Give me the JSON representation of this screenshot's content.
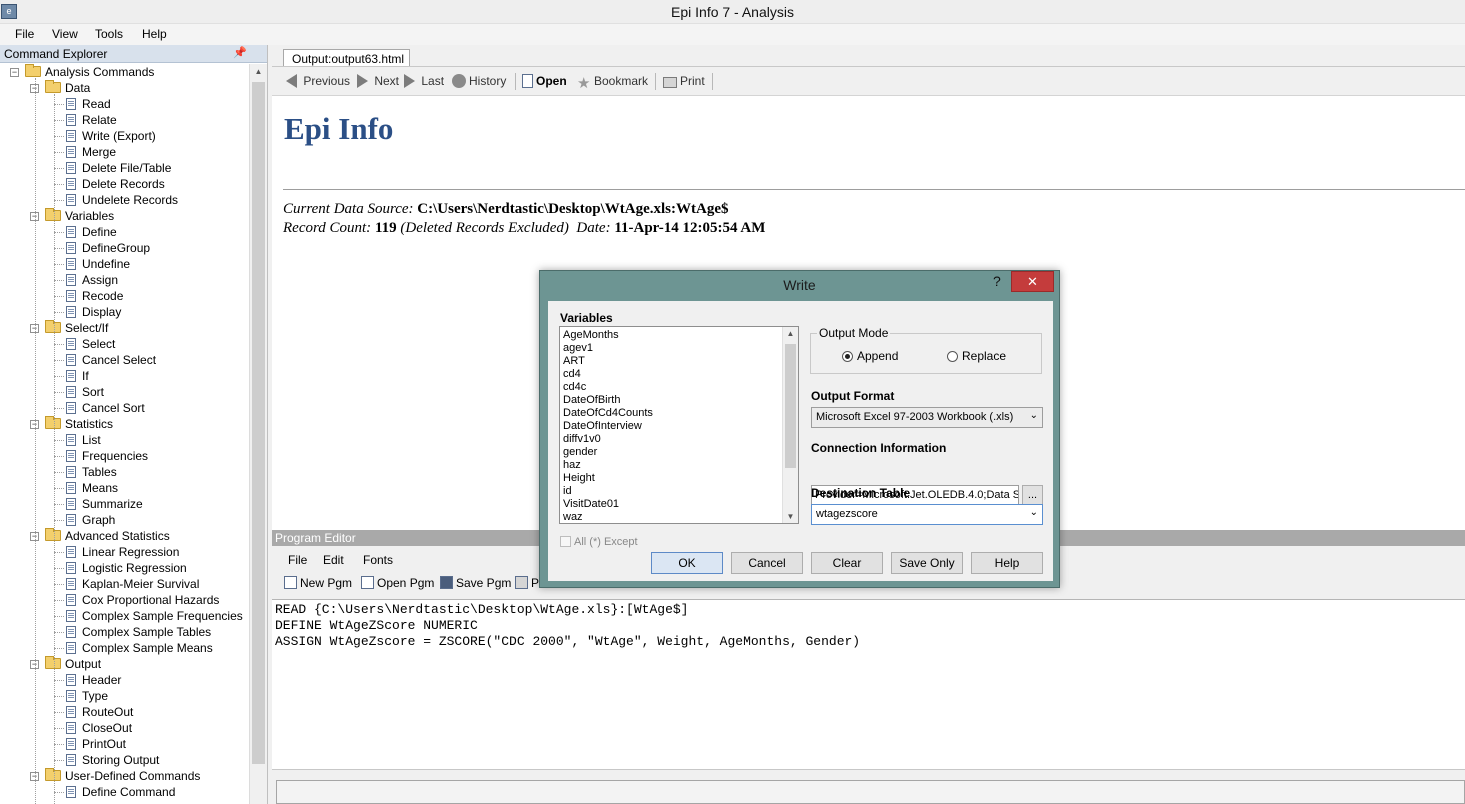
{
  "window": {
    "title": "Epi Info 7 - Analysis",
    "app_icon_glyph": "e"
  },
  "menu": [
    "File",
    "View",
    "Tools",
    "Help"
  ],
  "command_explorer": {
    "title": "Command Explorer",
    "pin_glyph": "📌",
    "tree": [
      {
        "label": "Analysis Commands",
        "level": 0,
        "folder": true
      },
      {
        "label": "Data",
        "level": 1,
        "folder": true
      },
      {
        "label": "Read",
        "level": 2
      },
      {
        "label": "Relate",
        "level": 2
      },
      {
        "label": "Write (Export)",
        "level": 2
      },
      {
        "label": "Merge",
        "level": 2
      },
      {
        "label": "Delete File/Table",
        "level": 2
      },
      {
        "label": "Delete Records",
        "level": 2
      },
      {
        "label": "Undelete Records",
        "level": 2
      },
      {
        "label": "Variables",
        "level": 1,
        "folder": true
      },
      {
        "label": "Define",
        "level": 2
      },
      {
        "label": "DefineGroup",
        "level": 2
      },
      {
        "label": "Undefine",
        "level": 2
      },
      {
        "label": "Assign",
        "level": 2
      },
      {
        "label": "Recode",
        "level": 2
      },
      {
        "label": "Display",
        "level": 2
      },
      {
        "label": "Select/If",
        "level": 1,
        "folder": true
      },
      {
        "label": "Select",
        "level": 2
      },
      {
        "label": "Cancel Select",
        "level": 2
      },
      {
        "label": "If",
        "level": 2
      },
      {
        "label": "Sort",
        "level": 2
      },
      {
        "label": "Cancel Sort",
        "level": 2
      },
      {
        "label": "Statistics",
        "level": 1,
        "folder": true
      },
      {
        "label": "List",
        "level": 2
      },
      {
        "label": "Frequencies",
        "level": 2
      },
      {
        "label": "Tables",
        "level": 2
      },
      {
        "label": "Means",
        "level": 2
      },
      {
        "label": "Summarize",
        "level": 2
      },
      {
        "label": "Graph",
        "level": 2
      },
      {
        "label": "Advanced Statistics",
        "level": 1,
        "folder": true
      },
      {
        "label": "Linear Regression",
        "level": 2
      },
      {
        "label": "Logistic Regression",
        "level": 2
      },
      {
        "label": "Kaplan-Meier Survival",
        "level": 2
      },
      {
        "label": "Cox Proportional Hazards",
        "level": 2
      },
      {
        "label": "Complex Sample Frequencies",
        "level": 2
      },
      {
        "label": "Complex Sample Tables",
        "level": 2
      },
      {
        "label": "Complex Sample Means",
        "level": 2
      },
      {
        "label": "Output",
        "level": 1,
        "folder": true
      },
      {
        "label": "Header",
        "level": 2
      },
      {
        "label": "Type",
        "level": 2
      },
      {
        "label": "RouteOut",
        "level": 2
      },
      {
        "label": "CloseOut",
        "level": 2
      },
      {
        "label": "PrintOut",
        "level": 2
      },
      {
        "label": "Storing Output",
        "level": 2
      },
      {
        "label": "User-Defined Commands",
        "level": 1,
        "folder": true
      },
      {
        "label": "Define Command",
        "level": 2
      }
    ]
  },
  "output": {
    "tab_label": "Output:output63.html",
    "toolbar": {
      "previous": "Previous",
      "next": "Next",
      "last": "Last",
      "history": "History",
      "open": "Open",
      "bookmark": "Bookmark",
      "print": "Print"
    },
    "heading": "Epi Info",
    "data_source_label": "Current Data Source:",
    "data_source_value": "C:\\Users\\Nerdtastic\\Desktop\\WtAge.xls:WtAge$",
    "record_count_label": "Record Count:",
    "record_count_value": "119",
    "record_count_note": "(Deleted Records Excluded)",
    "date_label": "Date:",
    "date_value": "11-Apr-14 12:05:54 AM"
  },
  "program_editor": {
    "title": "Program Editor",
    "menu": [
      "File",
      "Edit",
      "Fonts"
    ],
    "toolbar": {
      "new_pgm": "New Pgm",
      "open_pgm": "Open Pgm",
      "save_pgm": "Save Pgm",
      "print_partial": "P"
    },
    "code": [
      "READ {C:\\Users\\Nerdtastic\\Desktop\\WtAge.xls}:[WtAge$]",
      "DEFINE WtAgeZScore NUMERIC",
      "ASSIGN WtAgeZscore = ZSCORE(\"CDC 2000\", \"WtAge\", Weight, AgeMonths, Gender)"
    ]
  },
  "dialog": {
    "title": "Write",
    "help_glyph": "?",
    "close_glyph": "✕",
    "variables_label": "Variables",
    "variables": [
      "AgeMonths",
      "agev1",
      "ART",
      "cd4",
      "cd4c",
      "DateOfBirth",
      "DateOfCd4Counts",
      "DateOfInterview",
      "diffv1v0",
      "gender",
      "haz",
      "Height",
      "id",
      "VisitDate01",
      "waz"
    ],
    "all_except_label": "All (*) Except",
    "output_mode_label": "Output Mode",
    "append_label": "Append",
    "replace_label": "Replace",
    "output_mode_selected": "Append",
    "output_format_label": "Output Format",
    "output_format_value": "Microsoft Excel 97-2003 Workbook (.xls)",
    "connection_label": "Connection Information",
    "connection_value": "Provider=Microsoft.Jet.OLEDB.4.0;Data Sc",
    "browse_label": "...",
    "destination_label": "Destination Table",
    "destination_value": "wtagezscore",
    "buttons": {
      "ok": "OK",
      "cancel": "Cancel",
      "clear": "Clear",
      "save_only": "Save Only",
      "help": "Help"
    }
  }
}
